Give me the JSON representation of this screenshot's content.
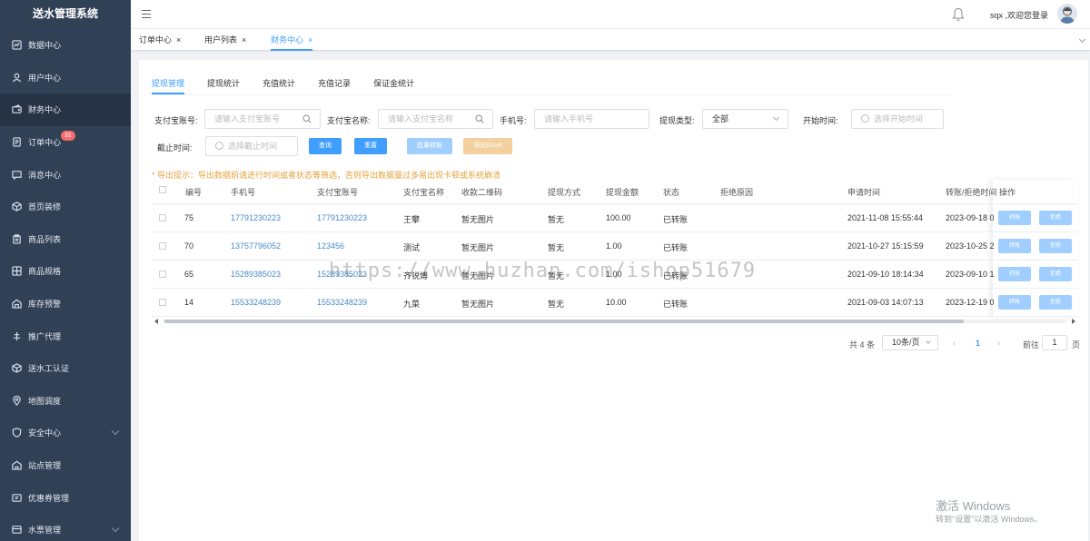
{
  "app_title": "送水管理系统",
  "sidebar": {
    "items": [
      {
        "label": "数据中心",
        "icon": "dashboard-icon"
      },
      {
        "label": "用户中心",
        "icon": "user-icon"
      },
      {
        "label": "财务中心",
        "icon": "wallet-icon",
        "active": true
      },
      {
        "label": "订单中心",
        "icon": "order-icon",
        "badge": "31"
      },
      {
        "label": "消息中心",
        "icon": "message-icon"
      },
      {
        "label": "首页装修",
        "icon": "box-icon"
      },
      {
        "label": "商品列表",
        "icon": "clipboard-icon"
      },
      {
        "label": "商品规格",
        "icon": "grid-icon"
      },
      {
        "label": "库存预警",
        "icon": "warehouse-icon"
      },
      {
        "label": "推广代理",
        "icon": "share-icon"
      },
      {
        "label": "送水工认证",
        "icon": "cube-icon"
      },
      {
        "label": "地图调度",
        "icon": "location-icon"
      },
      {
        "label": "安全中心",
        "icon": "shield-icon",
        "expandable": true
      },
      {
        "label": "站点管理",
        "icon": "station-icon"
      },
      {
        "label": "优惠券管理",
        "icon": "coupon-icon"
      },
      {
        "label": "水票管理",
        "icon": "ticket-icon",
        "expandable": true
      }
    ]
  },
  "navbar": {
    "user_text": "sqx ,欢迎您登录"
  },
  "tags": [
    {
      "label": "订单中心",
      "close": "×"
    },
    {
      "label": "用户列表",
      "close": "×"
    },
    {
      "label": "财务中心",
      "close": "×",
      "active": true
    }
  ],
  "subtabs": [
    "提现管理",
    "提现统计",
    "充值统计",
    "充值记录",
    "保证金统计"
  ],
  "filters": {
    "alipay_account_label": "支付宝账号:",
    "alipay_account_placeholder": "请输入支付宝账号",
    "alipay_name_label": "支付宝名称:",
    "alipay_name_placeholder": "请输入支付宝名称",
    "phone_label": "手机号:",
    "phone_placeholder": "请输入手机号",
    "type_label": "提现类型:",
    "type_value": "全部",
    "start_label": "开始时间:",
    "start_placeholder": "选择开始时间",
    "end_label": "截止时间:",
    "end_placeholder": "选择截止时间"
  },
  "buttons": {
    "query": "查询",
    "reset": "重置",
    "batch_transfer": "批量转账",
    "export": "导出Excel"
  },
  "tip": "* 导出提示：导出数据前请进行时间或者状态等筛选，否则导出数据量过多易出现卡顿或系统崩溃",
  "table": {
    "headers": [
      "编号",
      "手机号",
      "支付宝账号",
      "支付宝名称",
      "收款二维码",
      "提现方式",
      "提现金额",
      "状态",
      "拒绝原因",
      "申请时间",
      "转账/拒绝时间",
      "操作"
    ],
    "rows": [
      {
        "id": "75",
        "phone": "17791230223",
        "account": "17791230223",
        "name": "王攀",
        "qr": "暂无图片",
        "method": "暂无",
        "amount": "100.00",
        "status": "已转账",
        "reason": "",
        "apply_time": "2021-11-08 15:55:44",
        "done_time": "2023-09-18 0"
      },
      {
        "id": "70",
        "phone": "13757796052",
        "account": "123456",
        "name": "测试",
        "qr": "暂无图片",
        "method": "暂无",
        "amount": "1.00",
        "status": "已转账",
        "reason": "",
        "apply_time": "2021-10-27 15:15:59",
        "done_time": "2023-10-25 2"
      },
      {
        "id": "65",
        "phone": "15289385023",
        "account": "15289385023",
        "name": "齐锐博",
        "qr": "暂无图片",
        "method": "暂无",
        "amount": "1.00",
        "status": "已转账",
        "reason": "",
        "apply_time": "2021-09-10 18:14:34",
        "done_time": "2023-09-10 1"
      },
      {
        "id": "14",
        "phone": "15533248239",
        "account": "15533248239",
        "name": "九菜",
        "qr": "暂无图片",
        "method": "暂无",
        "amount": "10.00",
        "status": "已转账",
        "reason": "",
        "apply_time": "2021-09-03 14:07:13",
        "done_time": "2023-12-19 0"
      }
    ],
    "op_transfer": "转账",
    "op_reject": "拒绝"
  },
  "pager": {
    "total": "共 4 条",
    "size": "10条/页",
    "prev": "‹",
    "current": "1",
    "next": "›",
    "goto": "前往",
    "page_input": "1",
    "page_unit": "页"
  },
  "watermark": "https://www.huzhan.com/ishop51679",
  "windows": {
    "line1": "激活 Windows",
    "line2": "转到\"设置\"以激活 Windows。"
  }
}
